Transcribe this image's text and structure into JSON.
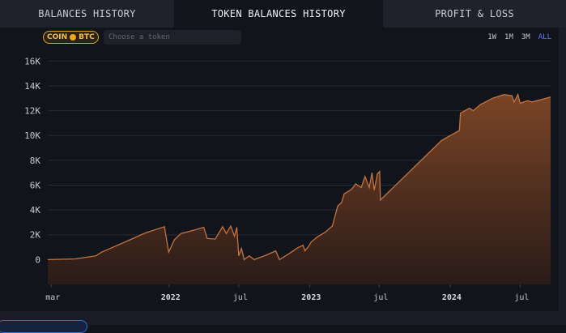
{
  "tabs": [
    {
      "label": "BALANCES HISTORY",
      "active": false
    },
    {
      "label": "TOKEN BALANCES HISTORY",
      "active": true
    },
    {
      "label": "PROFIT & LOSS",
      "active": false
    }
  ],
  "toggle": {
    "left": "COIN",
    "right": "BTC"
  },
  "search": {
    "placeholder": "Choose a token"
  },
  "ranges": [
    {
      "label": "1W",
      "active": false
    },
    {
      "label": "1M",
      "active": false
    },
    {
      "label": "3M",
      "active": false
    },
    {
      "label": "ALL",
      "active": true
    }
  ],
  "colors": {
    "line": "#c4733f",
    "fill_top": "#7a4426",
    "fill_bottom": "#2a1b18",
    "accent": "#6b78ff"
  },
  "chart_data": {
    "type": "area",
    "title": "",
    "xlabel": "",
    "ylabel": "",
    "ylim": [
      -2000,
      17000
    ],
    "xlim": [
      "2021-02-20",
      "2024-09-18"
    ],
    "yticks": [
      0,
      2000,
      4000,
      6000,
      8000,
      10000,
      12000,
      14000,
      16000
    ],
    "ytick_labels": [
      "0",
      "2K",
      "4K",
      "6K",
      "8K",
      "10K",
      "12K",
      "14K",
      "16K"
    ],
    "xticks": [
      {
        "date": "2021-03-01",
        "label": "mar",
        "bold": false
      },
      {
        "date": "2022-01-01",
        "label": "2022",
        "bold": true
      },
      {
        "date": "2022-07-01",
        "label": "jul",
        "bold": false
      },
      {
        "date": "2023-01-01",
        "label": "2023",
        "bold": true
      },
      {
        "date": "2023-07-01",
        "label": "jul",
        "bold": false
      },
      {
        "date": "2024-01-01",
        "label": "2024",
        "bold": true
      },
      {
        "date": "2024-07-01",
        "label": "jul",
        "bold": false
      }
    ],
    "grid": true,
    "series": [
      {
        "points": [
          [
            "2021-02-20",
            0
          ],
          [
            "2021-05-01",
            50
          ],
          [
            "2021-06-25",
            300
          ],
          [
            "2021-07-10",
            600
          ],
          [
            "2021-09-15",
            1500
          ],
          [
            "2021-11-01",
            2150
          ],
          [
            "2021-12-20",
            2650
          ],
          [
            "2021-12-31",
            600
          ],
          [
            "2022-01-15",
            1600
          ],
          [
            "2022-02-01",
            2100
          ],
          [
            "2022-03-10",
            2400
          ],
          [
            "2022-04-01",
            2600
          ],
          [
            "2022-04-10",
            1700
          ],
          [
            "2022-05-01",
            1650
          ],
          [
            "2022-05-20",
            2650
          ],
          [
            "2022-05-30",
            2100
          ],
          [
            "2022-06-10",
            2700
          ],
          [
            "2022-06-20",
            1900
          ],
          [
            "2022-06-26",
            2600
          ],
          [
            "2022-07-01",
            300
          ],
          [
            "2022-07-08",
            900
          ],
          [
            "2022-07-15",
            0
          ],
          [
            "2022-07-28",
            300
          ],
          [
            "2022-08-10",
            0
          ],
          [
            "2022-09-10",
            350
          ],
          [
            "2022-10-05",
            700
          ],
          [
            "2022-10-15",
            0
          ],
          [
            "2022-11-10",
            500
          ],
          [
            "2022-12-01",
            950
          ],
          [
            "2022-12-15",
            1150
          ],
          [
            "2022-12-20",
            700
          ],
          [
            "2022-12-30",
            1100
          ],
          [
            "2023-01-05",
            1400
          ],
          [
            "2023-01-20",
            1800
          ],
          [
            "2023-02-10",
            2200
          ],
          [
            "2023-03-01",
            2700
          ],
          [
            "2023-03-15",
            4300
          ],
          [
            "2023-03-25",
            4600
          ],
          [
            "2023-04-01",
            5300
          ],
          [
            "2023-04-20",
            5650
          ],
          [
            "2023-05-01",
            6100
          ],
          [
            "2023-05-15",
            5800
          ],
          [
            "2023-05-25",
            6700
          ],
          [
            "2023-06-05",
            5800
          ],
          [
            "2023-06-12",
            7000
          ],
          [
            "2023-06-18",
            5600
          ],
          [
            "2023-06-26",
            6900
          ],
          [
            "2023-07-02",
            7100
          ],
          [
            "2023-07-04",
            4800
          ],
          [
            "2023-12-10",
            9600
          ],
          [
            "2024-01-25",
            10400
          ],
          [
            "2024-01-28",
            11800
          ],
          [
            "2024-02-20",
            12200
          ],
          [
            "2024-03-01",
            12000
          ],
          [
            "2024-03-20",
            12500
          ],
          [
            "2024-04-20",
            13000
          ],
          [
            "2024-05-20",
            13300
          ],
          [
            "2024-06-10",
            13200
          ],
          [
            "2024-06-15",
            12700
          ],
          [
            "2024-06-25",
            13300
          ],
          [
            "2024-07-01",
            12600
          ],
          [
            "2024-07-20",
            12800
          ],
          [
            "2024-08-01",
            12700
          ],
          [
            "2024-09-18",
            13100
          ]
        ]
      }
    ]
  }
}
